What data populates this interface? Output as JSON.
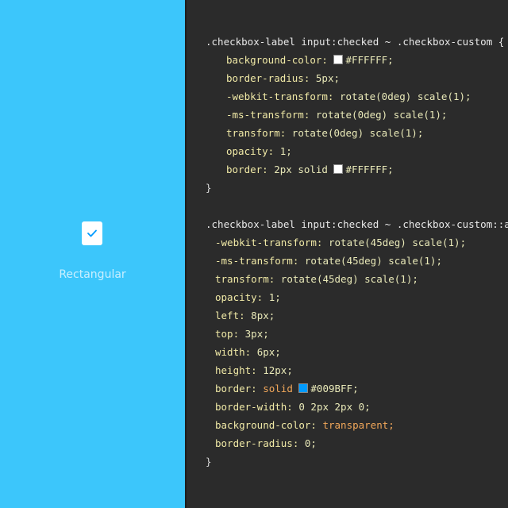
{
  "preview": {
    "background": "#3CC6FB",
    "checkbox_label": "Rectangular",
    "checkbox_checked": true,
    "check_icon": "checkmark-icon"
  },
  "editor": {
    "rule1": {
      "selector": ".checkbox-label input:checked ~ .checkbox-custom {",
      "decls": [
        {
          "prop": "background-color:",
          "value": "#FFFFFF;",
          "swatch": "#FFFFFF"
        },
        {
          "prop": "border-radius:",
          "value": "5px;"
        },
        {
          "prop": "-webkit-transform:",
          "value": "rotate(0deg) scale(1);"
        },
        {
          "prop": "-ms-transform:",
          "value": "rotate(0deg) scale(1);"
        },
        {
          "prop": "transform:",
          "value": "rotate(0deg) scale(1);"
        },
        {
          "prop": "opacity:",
          "value": "1;"
        },
        {
          "prop": "border:",
          "value": "2px solid",
          "value2": "#FFFFFF;",
          "swatch": "#FFFFFF"
        }
      ],
      "close": "}"
    },
    "rule2": {
      "selector": ".checkbox-label input:checked ~ .checkbox-custom::after {",
      "decls": [
        {
          "prop": "-webkit-transform:",
          "value": "rotate(45deg) scale(1);"
        },
        {
          "prop": "-ms-transform:",
          "value": "rotate(45deg) scale(1);"
        },
        {
          "prop": "transform:",
          "value": "rotate(45deg) scale(1);"
        },
        {
          "prop": "opacity:",
          "value": "1;"
        },
        {
          "prop": "left:",
          "value": "8px;"
        },
        {
          "prop": "top:",
          "value": "3px;"
        },
        {
          "prop": "width:",
          "value": "6px;"
        },
        {
          "prop": "height:",
          "value": "12px;"
        },
        {
          "prop": "border:",
          "value": "solid",
          "value2": "#009BFF;",
          "swatch": "#009BFF"
        },
        {
          "prop": "border-width:",
          "value": "0 2px 2px 0;"
        },
        {
          "prop": "background-color:",
          "value": "transparent;"
        },
        {
          "prop": "border-radius:",
          "value": "0;"
        }
      ],
      "close": "}"
    }
  }
}
